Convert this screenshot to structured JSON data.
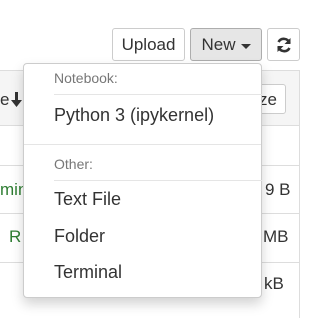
{
  "toolbar": {
    "upload_label": "Upload",
    "new_label": "New",
    "refresh_icon": "refresh-icon"
  },
  "background": {
    "header_fragment": "e",
    "sort_icon": "arrow-down-icon",
    "size_fragment": "ze",
    "rows": [
      {
        "name_fragment": "min",
        "size_fragment": "9 B",
        "name_color": "#2e7d32"
      },
      {
        "name_fragment": "R",
        "size_fragment": "MB",
        "name_color": "#2e7d32"
      },
      {
        "name_fragment": "",
        "size_fragment": "kB",
        "name_color": "#2e7d32"
      }
    ]
  },
  "menu": {
    "notebook_header": "Notebook:",
    "notebook_item": "Python 3 (ipykernel)",
    "other_header": "Other:",
    "other_items": [
      "Text File",
      "Folder",
      "Terminal"
    ]
  }
}
